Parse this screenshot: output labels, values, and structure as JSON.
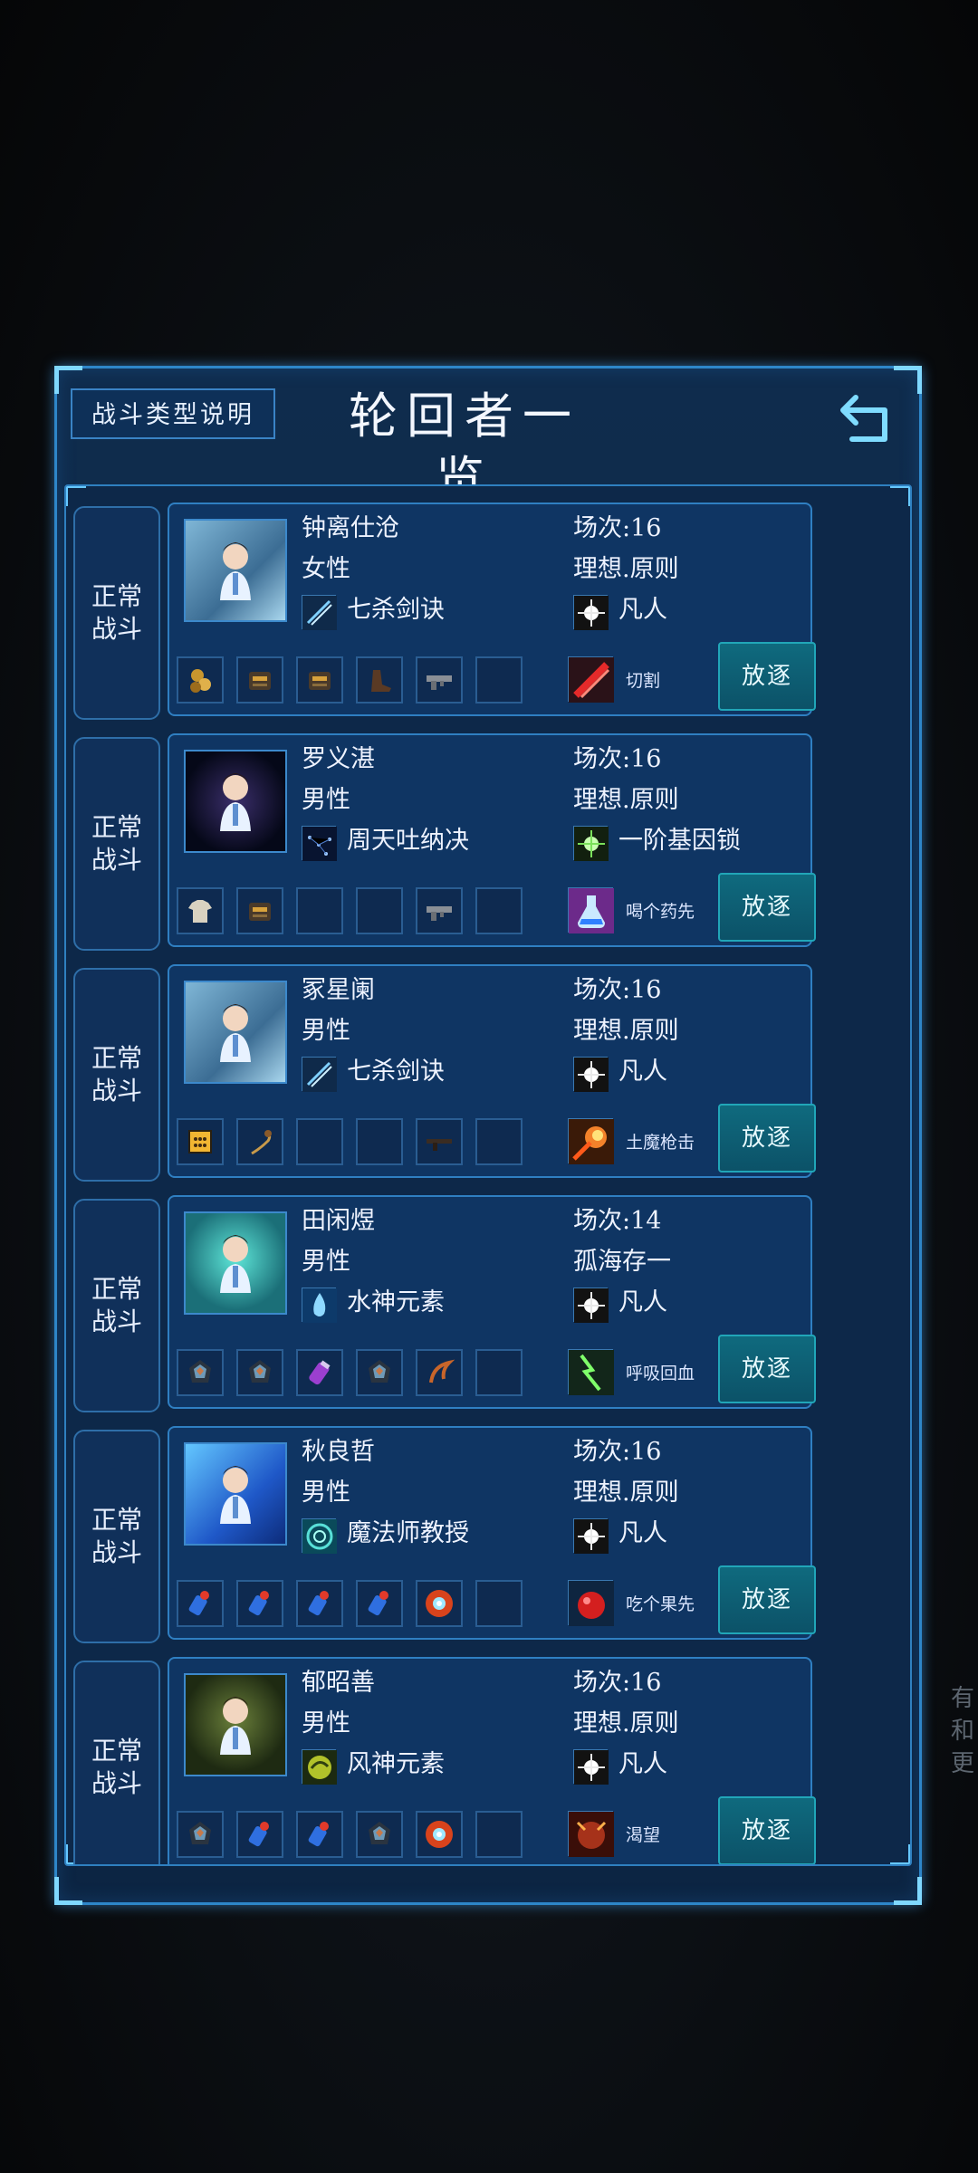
{
  "side_watermark": "有和更",
  "panel": {
    "help_button": "战斗类型说明",
    "title": "轮回者一览",
    "back_icon": "return-arrow-icon"
  },
  "list": [
    {
      "type_label": "正常战斗",
      "name": "钟离仕沧",
      "gender": "女性",
      "skill": "七杀剑诀",
      "skill_icon": "sword-slash-icon",
      "round": "场次:16",
      "trait": "理想.原则",
      "talent": "凡人",
      "talent_icon": "white-star-icon",
      "equipment": [
        "gold-nuggets-icon",
        "leather-armor-icon",
        "leather-armor-icon",
        "boot-icon",
        "gun-icon",
        "empty"
      ],
      "ability": "切割",
      "ability_icon": "red-slash-icon",
      "exile": "放逐"
    },
    {
      "type_label": "正常战斗",
      "name": "罗义湛",
      "gender": "男性",
      "skill": "周天吐纳决",
      "skill_icon": "constellation-icon",
      "round": "场次:16",
      "trait": "理想.原则",
      "talent": "一阶基因锁",
      "talent_icon": "green-star-icon",
      "equipment": [
        "shirt-icon",
        "leather-armor-icon",
        "empty",
        "empty",
        "gun-icon",
        "empty"
      ],
      "ability": "喝个药先",
      "ability_icon": "potion-flask-icon",
      "exile": "放逐"
    },
    {
      "type_label": "正常战斗",
      "name": "冢星阑",
      "gender": "男性",
      "skill": "七杀剑诀",
      "skill_icon": "sword-slash-icon",
      "round": "场次:16",
      "trait": "理想.原则",
      "talent": "凡人",
      "talent_icon": "white-star-icon",
      "equipment": [
        "abacus-icon",
        "whip-icon",
        "empty",
        "empty",
        "rifle-icon",
        "empty"
      ],
      "ability": "土魔枪击",
      "ability_icon": "fire-shot-icon",
      "exile": "放逐"
    },
    {
      "type_label": "正常战斗",
      "name": "田闲煜",
      "gender": "男性",
      "skill": "水神元素",
      "skill_icon": "water-spirit-icon",
      "round": "场次:14",
      "trait": "孤海存一",
      "talent": "凡人",
      "talent_icon": "white-star-icon",
      "equipment": [
        "crystal-ore-icon",
        "crystal-ore-icon",
        "purple-vial-icon",
        "crystal-ore-icon",
        "claw-icon",
        "empty"
      ],
      "ability": "呼吸回血",
      "ability_icon": "green-lightning-icon",
      "exile": "放逐"
    },
    {
      "type_label": "正常战斗",
      "name": "秋良哲",
      "gender": "男性",
      "skill": "魔法师教授",
      "skill_icon": "vortex-icon",
      "round": "场次:16",
      "trait": "理想.原则",
      "talent": "凡人",
      "talent_icon": "white-star-icon",
      "equipment": [
        "blue-bottle-icon",
        "blue-bottle-icon",
        "blue-bottle-icon",
        "blue-bottle-icon",
        "sun-burst-icon",
        "empty"
      ],
      "ability": "吃个果先",
      "ability_icon": "red-fruit-icon",
      "exile": "放逐"
    },
    {
      "type_label": "正常战斗",
      "name": "郁昭善",
      "gender": "男性",
      "skill": "风神元素",
      "skill_icon": "wind-orb-icon",
      "round": "场次:16",
      "trait": "理想.原则",
      "talent": "凡人",
      "talent_icon": "white-star-icon",
      "equipment": [
        "crystal-ore-icon",
        "blue-bottle-icon",
        "blue-bottle-icon",
        "crystal-ore-icon",
        "sun-burst-icon",
        "empty"
      ],
      "ability": "渴望",
      "ability_icon": "demon-icon",
      "exile": "放逐"
    }
  ],
  "colors": {
    "panel_border": "#2e86c9",
    "exile_button": "#0f6a7e",
    "text": "#eef3ff"
  }
}
